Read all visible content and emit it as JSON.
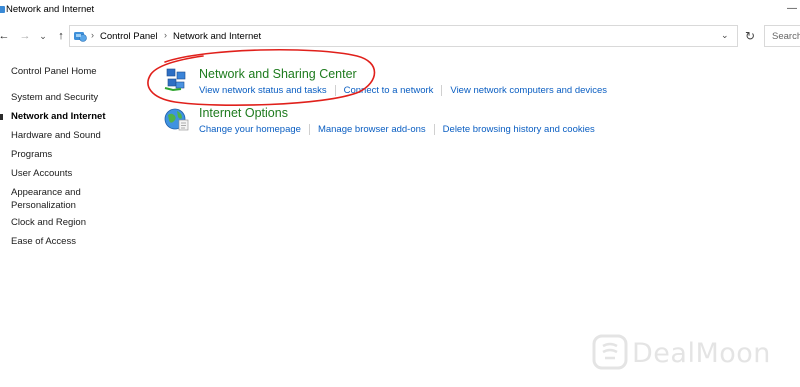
{
  "window": {
    "title": "Network and Internet"
  },
  "navigation": {
    "back_icon": "arrow-left-icon",
    "forward_icon": "arrow-right-icon",
    "recent_icon": "chevron-down-icon",
    "up_icon": "arrow-up-icon",
    "breadcrumbs": [
      "Control Panel",
      "Network and Internet"
    ],
    "refresh_icon": "refresh-icon",
    "search_placeholder": "Search"
  },
  "sidebar": {
    "home": "Control Panel Home",
    "items": [
      {
        "label": "System and Security",
        "active": false
      },
      {
        "label": "Network and Internet",
        "active": true
      },
      {
        "label": "Hardware and Sound",
        "active": false
      },
      {
        "label": "Programs",
        "active": false
      },
      {
        "label": "User Accounts",
        "active": false
      },
      {
        "label": "Appearance and\nPersonalization",
        "active": false
      },
      {
        "label": "Clock and Region",
        "active": false
      },
      {
        "label": "Ease of Access",
        "active": false
      }
    ]
  },
  "categories": [
    {
      "title": "Network and Sharing Center",
      "icon": "network-sharing-icon",
      "links": [
        "View network status and tasks",
        "Connect to a network",
        "View network computers and devices"
      ]
    },
    {
      "title": "Internet Options",
      "icon": "internet-options-globe-icon",
      "links": [
        "Change your homepage",
        "Manage browser add-ons",
        "Delete browsing history and cookies"
      ]
    }
  ],
  "watermark": {
    "text": "DealMoon"
  },
  "colors": {
    "category_title": "#1e7b1e",
    "link": "#0a5ec2",
    "annotation": "#e0201b"
  }
}
